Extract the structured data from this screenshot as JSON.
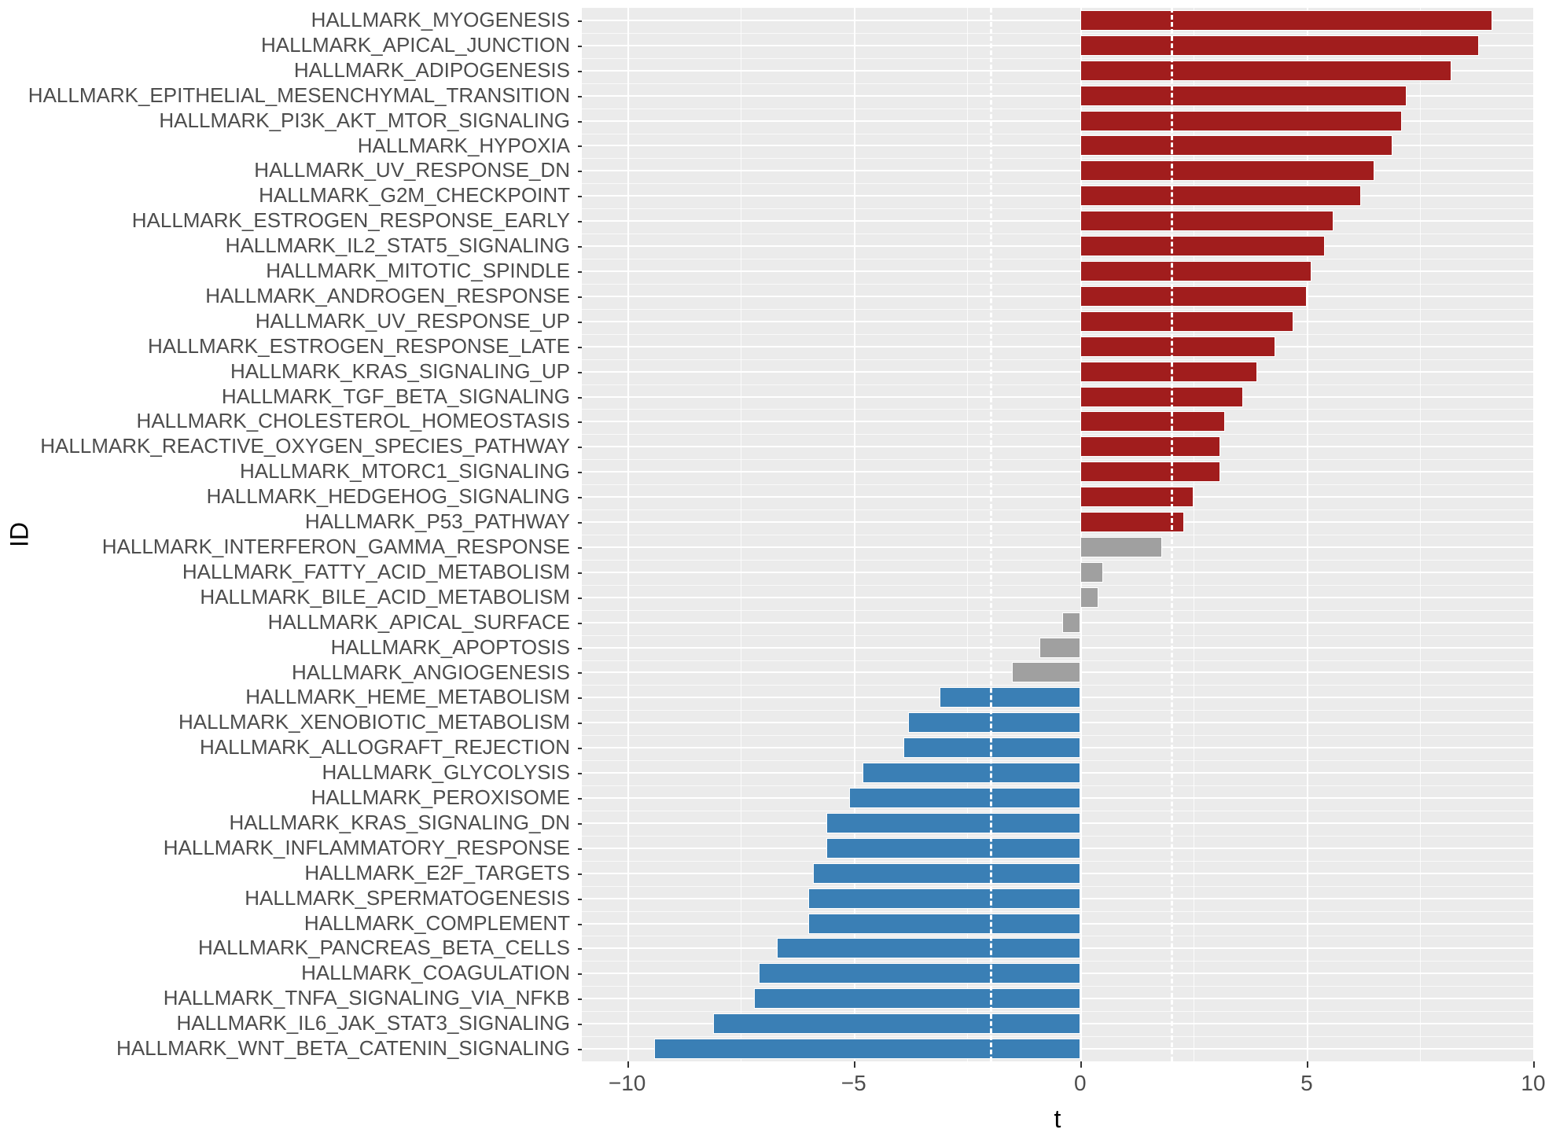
{
  "chart_data": {
    "type": "bar",
    "orientation": "horizontal",
    "xlabel": "t",
    "ylabel": "ID",
    "xlim": [
      -11,
      10
    ],
    "x_ticks": [
      -10,
      -5,
      0,
      5,
      10
    ],
    "ref_lines": [
      -2,
      2
    ],
    "colors": {
      "positive_sig": "#a11d1d",
      "nonsig": "#a0a0a0",
      "negative_sig": "#3a7fb5"
    },
    "categories": [
      "HALLMARK_MYOGENESIS",
      "HALLMARK_APICAL_JUNCTION",
      "HALLMARK_ADIPOGENESIS",
      "HALLMARK_EPITHELIAL_MESENCHYMAL_TRANSITION",
      "HALLMARK_PI3K_AKT_MTOR_SIGNALING",
      "HALLMARK_HYPOXIA",
      "HALLMARK_UV_RESPONSE_DN",
      "HALLMARK_G2M_CHECKPOINT",
      "HALLMARK_ESTROGEN_RESPONSE_EARLY",
      "HALLMARK_IL2_STAT5_SIGNALING",
      "HALLMARK_MITOTIC_SPINDLE",
      "HALLMARK_ANDROGEN_RESPONSE",
      "HALLMARK_UV_RESPONSE_UP",
      "HALLMARK_ESTROGEN_RESPONSE_LATE",
      "HALLMARK_KRAS_SIGNALING_UP",
      "HALLMARK_TGF_BETA_SIGNALING",
      "HALLMARK_CHOLESTEROL_HOMEOSTASIS",
      "HALLMARK_REACTIVE_OXYGEN_SPECIES_PATHWAY",
      "HALLMARK_MTORC1_SIGNALING",
      "HALLMARK_HEDGEHOG_SIGNALING",
      "HALLMARK_P53_PATHWAY",
      "HALLMARK_INTERFERON_GAMMA_RESPONSE",
      "HALLMARK_FATTY_ACID_METABOLISM",
      "HALLMARK_BILE_ACID_METABOLISM",
      "HALLMARK_APICAL_SURFACE",
      "HALLMARK_APOPTOSIS",
      "HALLMARK_ANGIOGENESIS",
      "HALLMARK_HEME_METABOLISM",
      "HALLMARK_XENOBIOTIC_METABOLISM",
      "HALLMARK_ALLOGRAFT_REJECTION",
      "HALLMARK_GLYCOLYSIS",
      "HALLMARK_PEROXISOME",
      "HALLMARK_KRAS_SIGNALING_DN",
      "HALLMARK_INFLAMMATORY_RESPONSE",
      "HALLMARK_E2F_TARGETS",
      "HALLMARK_SPERMATOGENESIS",
      "HALLMARK_COMPLEMENT",
      "HALLMARK_PANCREAS_BETA_CELLS",
      "HALLMARK_COAGULATION",
      "HALLMARK_TNFA_SIGNALING_VIA_NFKB",
      "HALLMARK_IL6_JAK_STAT3_SIGNALING",
      "HALLMARK_WNT_BETA_CATENIN_SIGNALING"
    ],
    "values": [
      9.1,
      8.8,
      8.2,
      7.2,
      7.1,
      6.9,
      6.5,
      6.2,
      5.6,
      5.4,
      5.1,
      5.0,
      4.7,
      4.3,
      3.9,
      3.6,
      3.2,
      3.1,
      3.1,
      2.5,
      2.3,
      1.8,
      0.5,
      0.4,
      -0.4,
      -0.9,
      -1.5,
      -3.1,
      -3.8,
      -3.9,
      -4.8,
      -5.1,
      -5.6,
      -5.6,
      -5.9,
      -6.0,
      -6.0,
      -6.7,
      -7.1,
      -7.2,
      -8.1,
      -9.4
    ],
    "groups": [
      "pos",
      "pos",
      "pos",
      "pos",
      "pos",
      "pos",
      "pos",
      "pos",
      "pos",
      "pos",
      "pos",
      "pos",
      "pos",
      "pos",
      "pos",
      "pos",
      "pos",
      "pos",
      "pos",
      "pos",
      "pos",
      "neu",
      "neu",
      "neu",
      "neu",
      "neu",
      "neu",
      "neg",
      "neg",
      "neg",
      "neg",
      "neg",
      "neg",
      "neg",
      "neg",
      "neg",
      "neg",
      "neg",
      "neg",
      "neg",
      "neg",
      "neg"
    ]
  }
}
